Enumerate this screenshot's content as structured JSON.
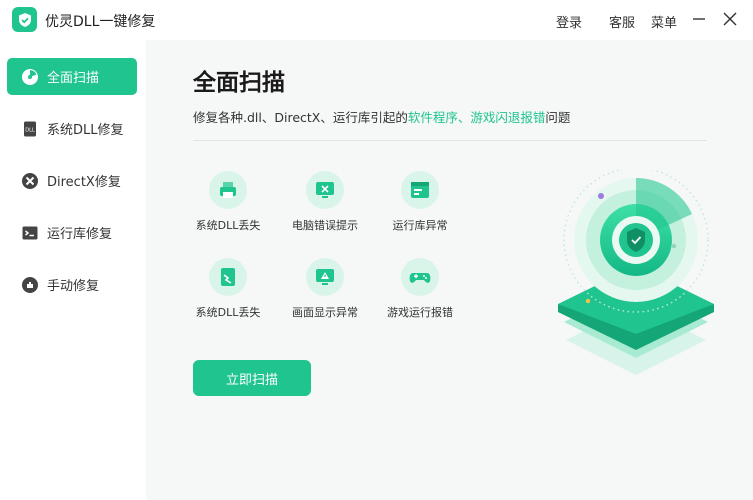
{
  "app": {
    "title": "优灵DLL一键修复"
  },
  "titlebar": {
    "login": "登录",
    "service": "客服",
    "menu": "菜单"
  },
  "sidebar": {
    "items": [
      {
        "label": "全面扫描",
        "icon": "radar-icon",
        "active": true
      },
      {
        "label": "系统DLL修复",
        "icon": "dll-file-icon"
      },
      {
        "label": "DirectX修复",
        "icon": "directx-icon"
      },
      {
        "label": "运行库修复",
        "icon": "terminal-icon"
      },
      {
        "label": "手动修复",
        "icon": "hand-icon"
      }
    ]
  },
  "main": {
    "title": "全面扫描",
    "subtitle_prefix": "修复各种.dll、DirectX、运行库引起的",
    "subtitle_highlight": "软件程序、游戏闪退报错",
    "subtitle_suffix": "问题",
    "features": [
      {
        "label": "系统DLL丢失",
        "icon": "printer-dll-icon"
      },
      {
        "label": "电脑错误提示",
        "icon": "monitor-error-icon"
      },
      {
        "label": "运行库异常",
        "icon": "window-runtime-icon"
      },
      {
        "label": "系统DLL丢失",
        "icon": "file-broken-icon"
      },
      {
        "label": "画面显示异常",
        "icon": "monitor-warning-icon"
      },
      {
        "label": "游戏运行报错",
        "icon": "gamepad-icon"
      }
    ],
    "scan_button": "立即扫描"
  },
  "colors": {
    "accent": "#1fc48f",
    "accent_light": "#d9f5ea",
    "background": "#f6f7f7"
  }
}
